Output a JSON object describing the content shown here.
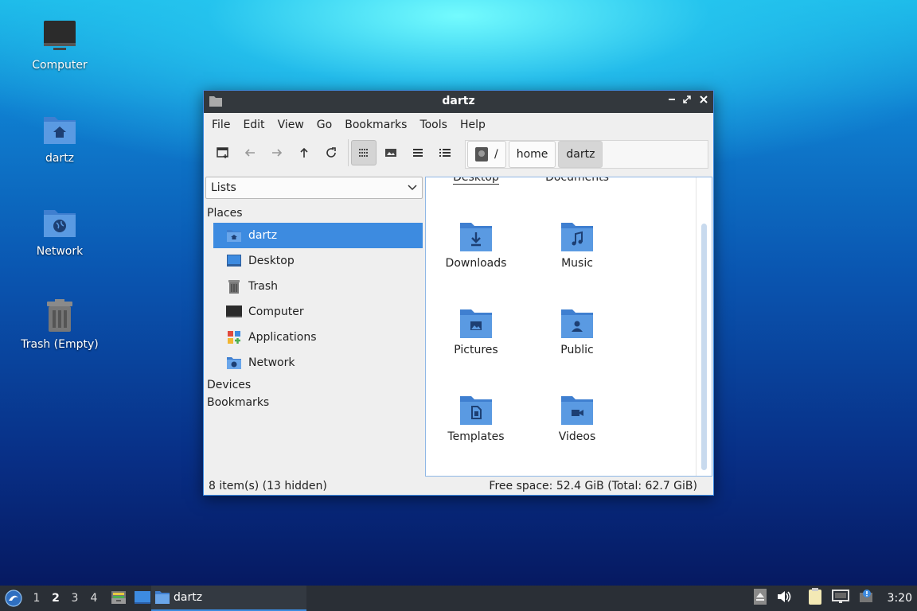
{
  "desktop": {
    "icons": [
      {
        "label": "Computer"
      },
      {
        "label": "dartz"
      },
      {
        "label": "Network"
      },
      {
        "label": "Trash (Empty)"
      }
    ]
  },
  "window": {
    "title": "dartz",
    "menu": [
      "File",
      "Edit",
      "View",
      "Go",
      "Bookmarks",
      "Tools",
      "Help"
    ],
    "path": [
      "/",
      "home",
      "dartz"
    ],
    "side_select": "Lists",
    "sections": {
      "places": "Places",
      "devices": "Devices",
      "bookmarks": "Bookmarks"
    },
    "places": [
      {
        "label": "dartz",
        "icon": "home-folder-icon",
        "selected": true
      },
      {
        "label": "Desktop",
        "icon": "desktop-icon"
      },
      {
        "label": "Trash",
        "icon": "trash-icon"
      },
      {
        "label": "Computer",
        "icon": "computer-icon"
      },
      {
        "label": "Applications",
        "icon": "applications-icon"
      },
      {
        "label": "Network",
        "icon": "network-icon"
      }
    ],
    "files": [
      {
        "label": "Desktop"
      },
      {
        "label": "Documents"
      },
      {
        "label": "Downloads",
        "icon": "download-folder-icon"
      },
      {
        "label": "Music",
        "icon": "music-folder-icon"
      },
      {
        "label": "Pictures",
        "icon": "pictures-folder-icon"
      },
      {
        "label": "Public",
        "icon": "public-folder-icon"
      },
      {
        "label": "Templates",
        "icon": "templates-folder-icon"
      },
      {
        "label": "Videos",
        "icon": "videos-folder-icon"
      }
    ],
    "status_left": "8 item(s) (13 hidden)",
    "status_right": "Free space: 52.4 GiB (Total: 62.7 GiB)"
  },
  "taskbar": {
    "workspaces": [
      "1",
      "2",
      "3",
      "4"
    ],
    "active_workspace": "2",
    "task_label": "dartz",
    "clock": "3:20"
  },
  "colors": {
    "accent": "#3d8be0",
    "folder": "#4a8fdc",
    "titlebar": "#33383d",
    "panel": "#2a2f36"
  }
}
